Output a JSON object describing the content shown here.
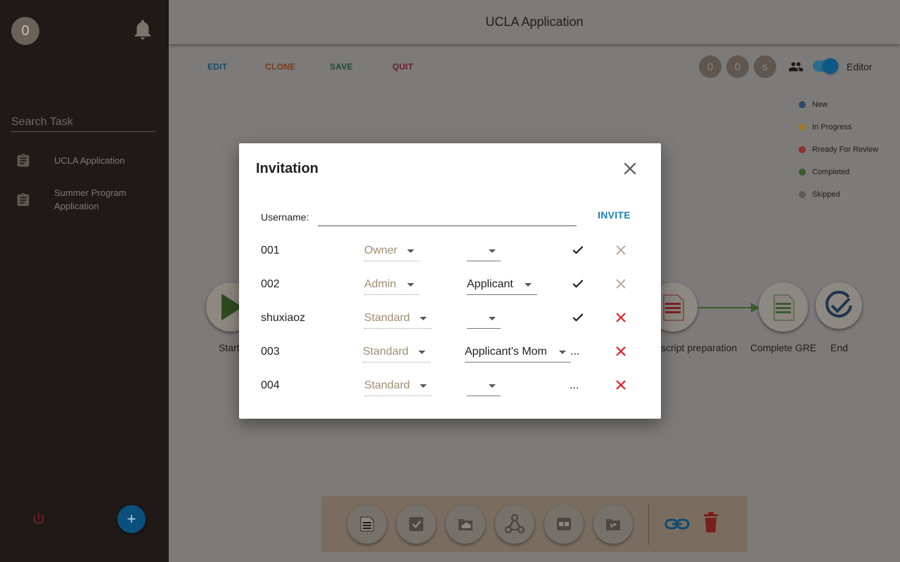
{
  "sidebar": {
    "avatar_text": "0",
    "search_placeholder": "Search Task",
    "tasks": [
      {
        "label": "UCLA Application"
      },
      {
        "label": "Summer Program Application"
      }
    ],
    "add_label": "+"
  },
  "header": {
    "title": "UCLA Application"
  },
  "toolbar": {
    "edit": "EDIT",
    "clone": "CLONE",
    "save": "SAVE",
    "quit": "QUIT",
    "counters": [
      "0",
      "0",
      "s"
    ],
    "editor_label": "Editor"
  },
  "legend": [
    {
      "label": "New",
      "color": "#2a4a6a"
    },
    {
      "label": "In Progress",
      "color": "#a0762a"
    },
    {
      "label": "Rready For Review",
      "color": "#8f2f2f"
    },
    {
      "label": "Completed",
      "color": "#3c5a30"
    },
    {
      "label": "Skipped",
      "color": "#5e5a55"
    }
  ],
  "flow": {
    "nodes": [
      "Start",
      "script preparation",
      "Complete GRE",
      "End"
    ]
  },
  "modal": {
    "title": "Invitation",
    "username_label": "Username:",
    "username_value": "",
    "invite_label": "INVITE",
    "rows": [
      {
        "user": "001",
        "role": "Owner",
        "relation": "",
        "status": "check",
        "ellipsis": "",
        "removable": false
      },
      {
        "user": "002",
        "role": "Admin",
        "relation": "Applicant",
        "status": "check",
        "ellipsis": "",
        "removable": false
      },
      {
        "user": "shuxiaoz",
        "role": "Standard",
        "relation": "",
        "status": "check",
        "ellipsis": "",
        "removable": true
      },
      {
        "user": "003",
        "role": "Standard",
        "relation": "Applicant's Mom",
        "status": "",
        "ellipsis": "...",
        "removable": true
      },
      {
        "user": "004",
        "role": "Standard",
        "relation": "",
        "status": "",
        "ellipsis": "...",
        "removable": true
      }
    ]
  },
  "colors": {
    "accent_blue": "#1a7fb8",
    "delete_red": "#e01f1f",
    "disabled_x": "#b9ada0"
  }
}
